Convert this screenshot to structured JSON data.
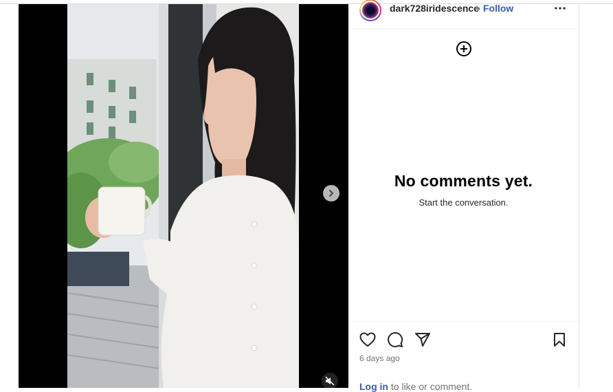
{
  "post": {
    "username": "dark728iridescence",
    "separator": "•",
    "follow_label": "Follow",
    "time_ago": "6 days ago"
  },
  "comments": {
    "empty_title": "No comments yet.",
    "empty_subtitle": "Start the conversation."
  },
  "footer": {
    "login_link": "Log in",
    "login_suffix": " to like or comment."
  },
  "icons": {
    "next": "chevron-right-icon",
    "mute": "speaker-muted-icon",
    "more": "more-horizontal-icon",
    "add": "plus-circle-icon",
    "like": "heart-icon",
    "comment": "comment-icon",
    "share": "send-icon",
    "save": "bookmark-icon"
  }
}
